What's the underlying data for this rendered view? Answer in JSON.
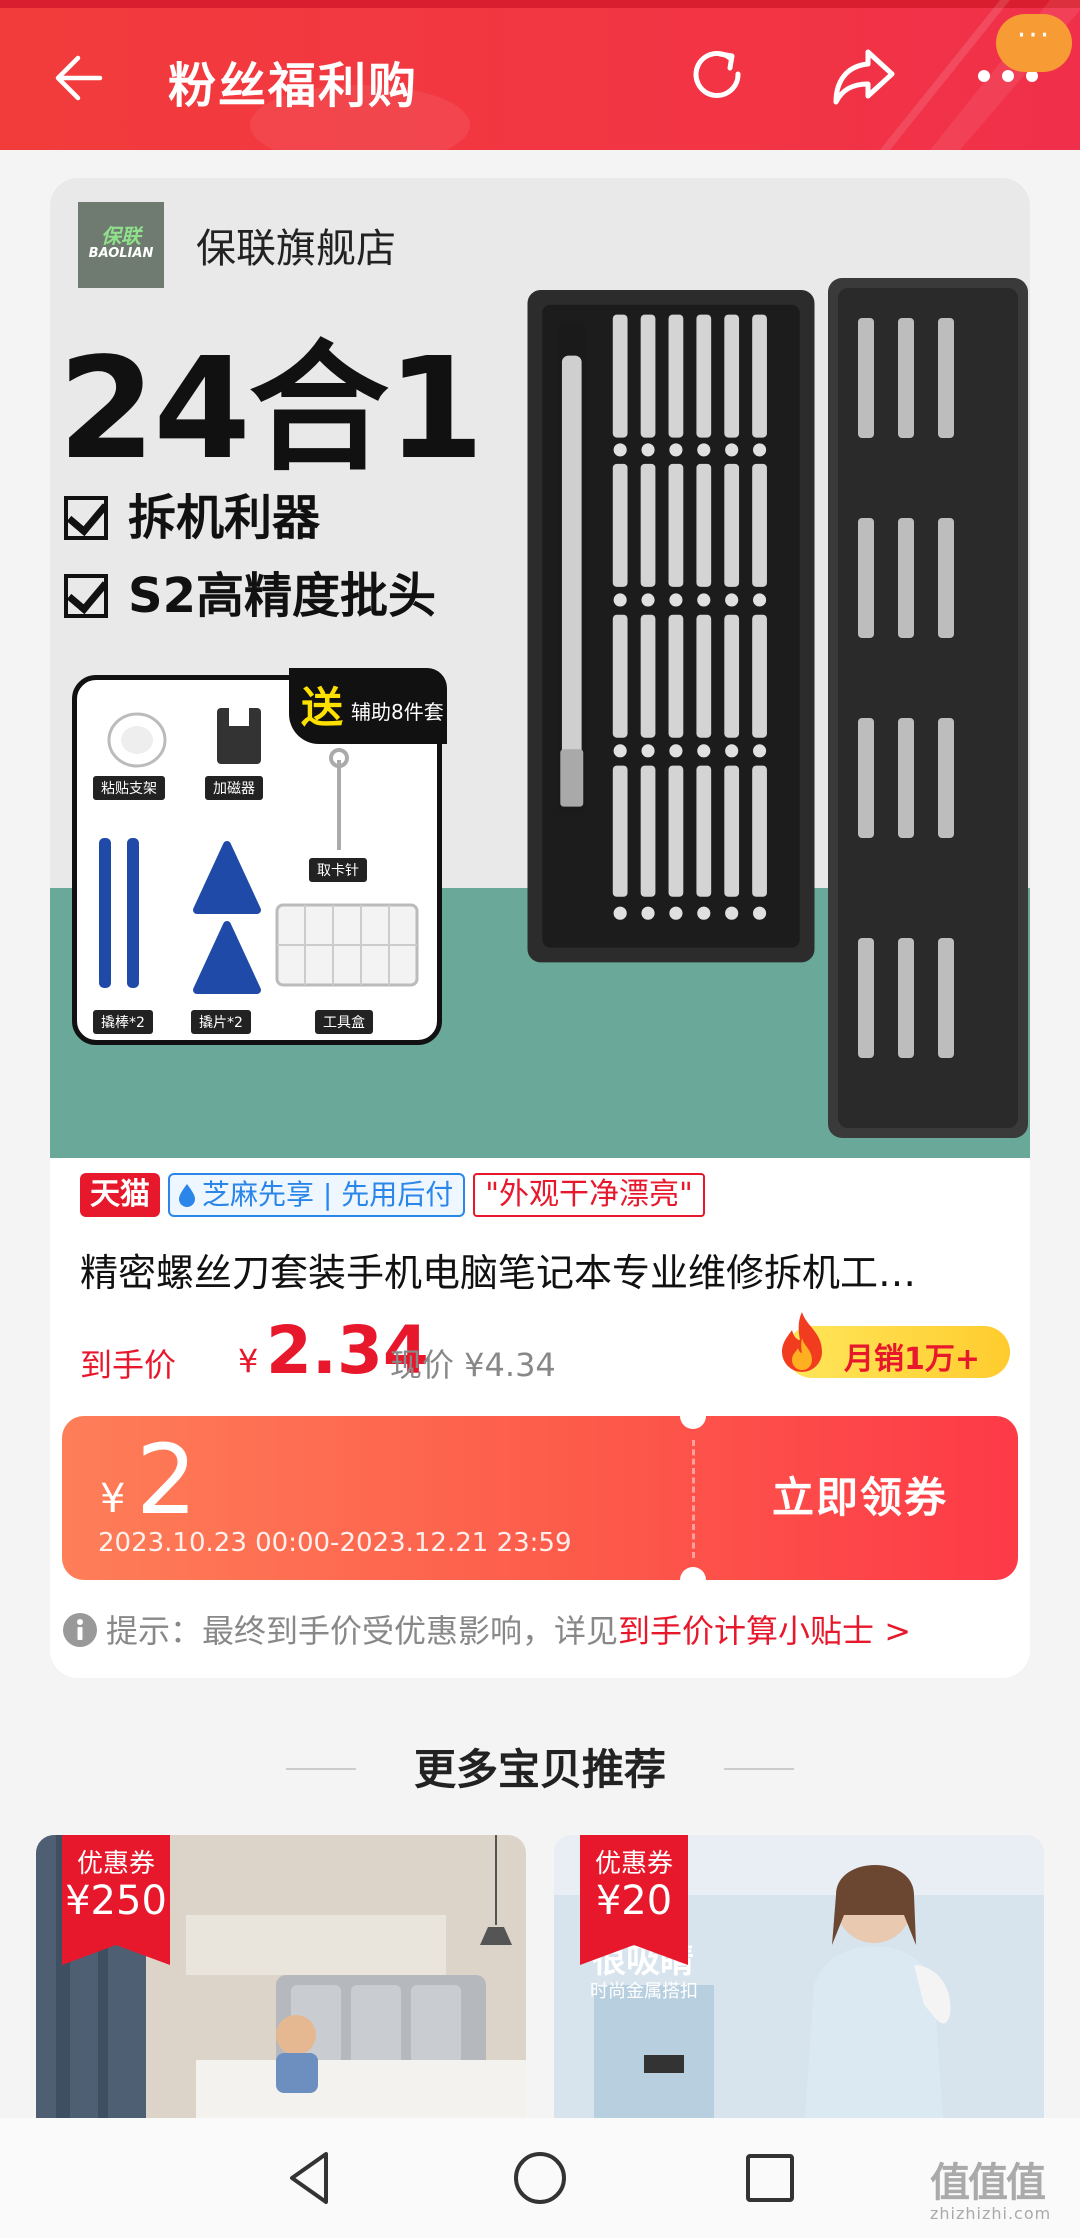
{
  "header": {
    "title": "粉丝福利购",
    "badge_text": "···"
  },
  "store": {
    "logo_cn": "保联",
    "logo_en": "BAOLIAN",
    "name": "保联旗舰店"
  },
  "product_image": {
    "headline": "24合1",
    "features": [
      "拆机利器",
      "S2高精度批头"
    ],
    "gift_song": "送",
    "gift_text": "辅助8件套",
    "gift_items": [
      "粘贴支架",
      "加磁器",
      "取卡针",
      "撬棒*2",
      "撬片*2",
      "工具盒"
    ]
  },
  "badges": {
    "tmall": "天猫",
    "zhima": "芝麻先享 | 先用后付",
    "review": "\"外观干净漂亮\""
  },
  "product": {
    "title": "精密螺丝刀套装手机电脑笔记本专业维修拆机工…",
    "price_label": "到手价",
    "price_yen": "¥",
    "price": "2.34",
    "original_price": "现价 ¥4.34",
    "sales": "月销1万+"
  },
  "coupon": {
    "yen": "¥",
    "amount": "2",
    "validity": "2023.10.23 00:00-2023.12.21 23:59",
    "button": "立即领券"
  },
  "tip": {
    "text": "提示：最终到手价受优惠影响，详见",
    "link": "到手价计算小贴士 >"
  },
  "recommend": {
    "title": "更多宝贝推荐",
    "items": [
      {
        "tag_label": "优惠券",
        "tag_value": "¥250"
      },
      {
        "tag_label": "优惠券",
        "tag_value": "¥20",
        "image_text": "很吸睛",
        "image_subtext": "时尚金属搭扣"
      }
    ]
  },
  "watermark": {
    "main": "值值值",
    "sub": "zhizhizhi.com"
  },
  "colors": {
    "accent_red": "#e8182c",
    "header_red": "#f23c3c",
    "coupon_orange": "#fe7e58",
    "gold": "#ffcc2e"
  }
}
